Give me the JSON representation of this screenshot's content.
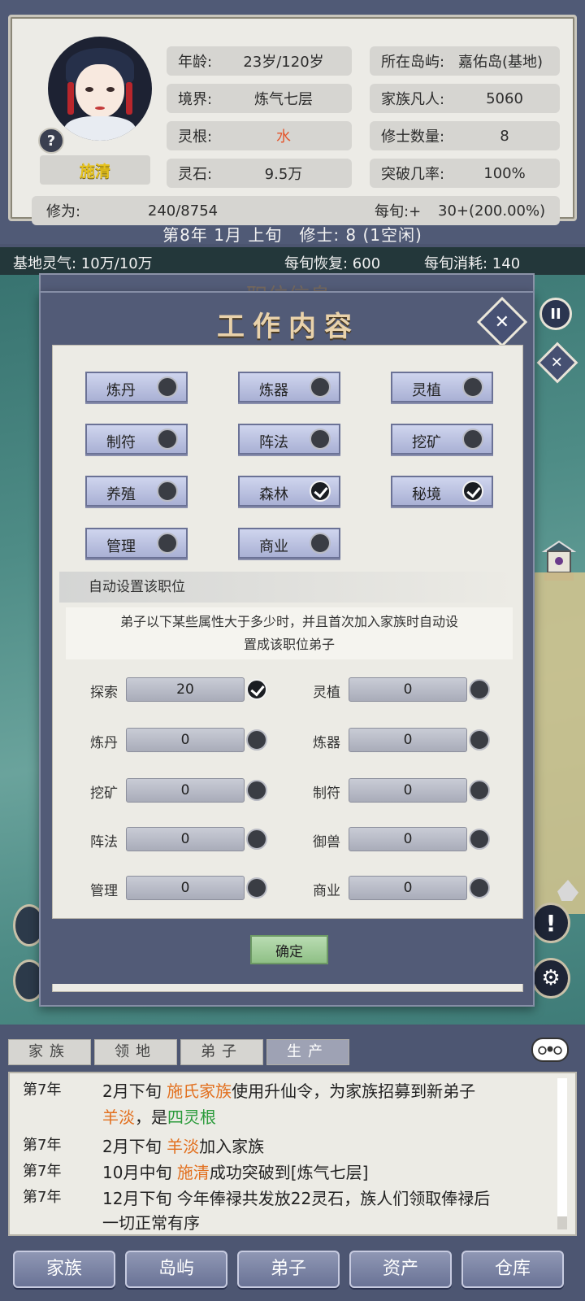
{
  "character": {
    "name": "施清",
    "help_icon": "?",
    "stats_left": [
      {
        "label": "年龄:",
        "value": "23岁/120岁"
      },
      {
        "label": "境界:",
        "value": "炼气七层"
      },
      {
        "label": "灵根:",
        "value": "水"
      },
      {
        "label": "灵石:",
        "value": "9.5万"
      }
    ],
    "stats_right": [
      {
        "label": "所在岛屿:",
        "value": "嘉佑岛(基地)"
      },
      {
        "label": "家族凡人:",
        "value": "5060"
      },
      {
        "label": "修士数量:",
        "value": "8"
      },
      {
        "label": "突破几率:",
        "value": "100%"
      }
    ],
    "cultivation_label": "修为:",
    "cultivation_value": "240/8754",
    "per_period_label": "每旬:+",
    "per_period_value": "30+(200.00%)"
  },
  "date_bar": "第8年 1月 上旬　修士: 8 (1空闲)",
  "resource_bar": {
    "spirit": "基地灵气: 10万/10万",
    "recovery": "每旬恢复: 600",
    "consumption": "每旬消耗: 140"
  },
  "modal": {
    "back_title": "职位信息",
    "title": "工作内容",
    "close_icon": "✕",
    "jobs": [
      {
        "label": "炼丹",
        "checked": false
      },
      {
        "label": "炼器",
        "checked": false
      },
      {
        "label": "灵植",
        "checked": false
      },
      {
        "label": "制符",
        "checked": false
      },
      {
        "label": "阵法",
        "checked": false
      },
      {
        "label": "挖矿",
        "checked": false
      },
      {
        "label": "养殖",
        "checked": false
      },
      {
        "label": "森林",
        "checked": true
      },
      {
        "label": "秘境",
        "checked": true
      },
      {
        "label": "管理",
        "checked": false
      },
      {
        "label": "商业",
        "checked": false
      }
    ],
    "auto_header": "自动设置该职位",
    "auto_desc_1": "弟子以下某些属性大于多少时，并且首次加入家族时自动设",
    "auto_desc_2": "置成该职位弟子",
    "attrs_left": [
      {
        "label": "探索",
        "value": "20",
        "checked": true
      },
      {
        "label": "炼丹",
        "value": "0",
        "checked": false
      },
      {
        "label": "挖矿",
        "value": "0",
        "checked": false
      },
      {
        "label": "阵法",
        "value": "0",
        "checked": false
      },
      {
        "label": "管理",
        "value": "0",
        "checked": false
      }
    ],
    "attrs_right": [
      {
        "label": "灵植",
        "value": "0",
        "checked": false
      },
      {
        "label": "炼器",
        "value": "0",
        "checked": false
      },
      {
        "label": "制符",
        "value": "0",
        "checked": false
      },
      {
        "label": "御兽",
        "value": "0",
        "checked": false
      },
      {
        "label": "商业",
        "value": "0",
        "checked": false
      }
    ],
    "confirm_label": "确定"
  },
  "side_buttons": {
    "pause_icon": "II",
    "close_icon": "✕",
    "alert_icon": "!",
    "gear_icon": "⚙"
  },
  "log_tabs": [
    "家族",
    "领地",
    "弟子",
    "生产"
  ],
  "log": {
    "entries": [
      {
        "year": "第7年",
        "p1": "2月下旬 ",
        "h1": "施氏家族",
        "p2": "使用升仙令，为家族招募到新弟子"
      },
      {
        "cont1": "羊淡",
        "cont2": "，是",
        "cont3": "四灵根"
      },
      {
        "year": "第7年",
        "p1": "2月下旬 ",
        "h1": "羊淡",
        "p2": "加入家族"
      },
      {
        "year": "第7年",
        "p1": "10月中旬 ",
        "h1": "施清",
        "p2": "成功突破到[炼气七层]"
      },
      {
        "year": "第7年",
        "p1": "12月下旬 今年俸禄共发放22灵石，族人们领取俸禄后"
      },
      {
        "cont": "一切正常有序"
      }
    ]
  },
  "bottom_nav": [
    "家族",
    "岛屿",
    "弟子",
    "资产",
    "仓库"
  ]
}
